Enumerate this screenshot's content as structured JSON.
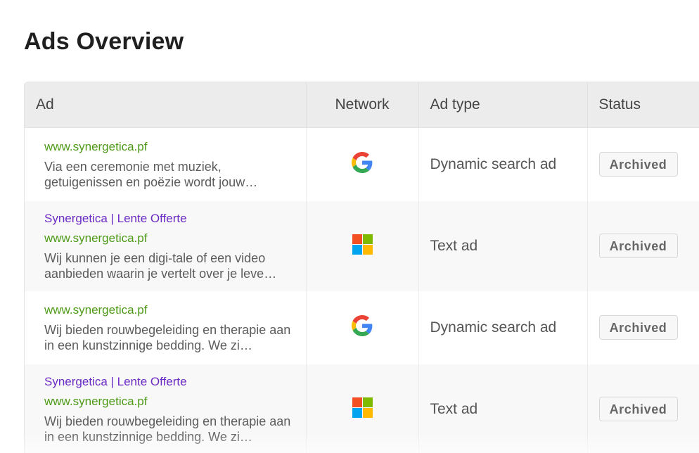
{
  "page": {
    "title": "Ads Overview"
  },
  "table": {
    "headers": {
      "ad": "Ad",
      "network": "Network",
      "ad_type": "Ad type",
      "status": "Status"
    },
    "rows": [
      {
        "headline": "",
        "url": "www.synergetica.pf",
        "description": "Via een ceremonie met muziek, getuigenissen en poëzie wordt jouw…",
        "network": "google-icon",
        "ad_type": "Dynamic search ad",
        "status": "Archived"
      },
      {
        "headline": "Synergetica | Lente Offerte",
        "url": "www.synergetica.pf",
        "description": "Wij kunnen je een digi-tale of een video aanbieden waarin je vertelt over je leve…",
        "network": "microsoft-icon",
        "ad_type": "Text ad",
        "status": "Archived"
      },
      {
        "headline": "",
        "url": "www.synergetica.pf",
        "description": "Wij bieden rouwbegeleiding en therapie aan in een kunstzinnige bedding. We zi…",
        "network": "google-icon",
        "ad_type": "Dynamic search ad",
        "status": "Archived"
      },
      {
        "headline": "Synergetica | Lente Offerte",
        "url": "www.synergetica.pf",
        "description": "Wij bieden rouwbegeleiding en therapie aan in een kunstzinnige bedding. We zi…",
        "network": "microsoft-icon",
        "ad_type": "Text ad",
        "status": "Archived"
      }
    ]
  },
  "colors": {
    "headline": "#6b2bc4",
    "url": "#4d9a17",
    "google_blue": "#4285F4",
    "google_red": "#EA4335",
    "google_yellow": "#FBBC05",
    "google_green": "#34A853",
    "ms_red": "#F25022",
    "ms_green": "#7FBA00",
    "ms_blue": "#00A4EF",
    "ms_yellow": "#FFB900"
  }
}
